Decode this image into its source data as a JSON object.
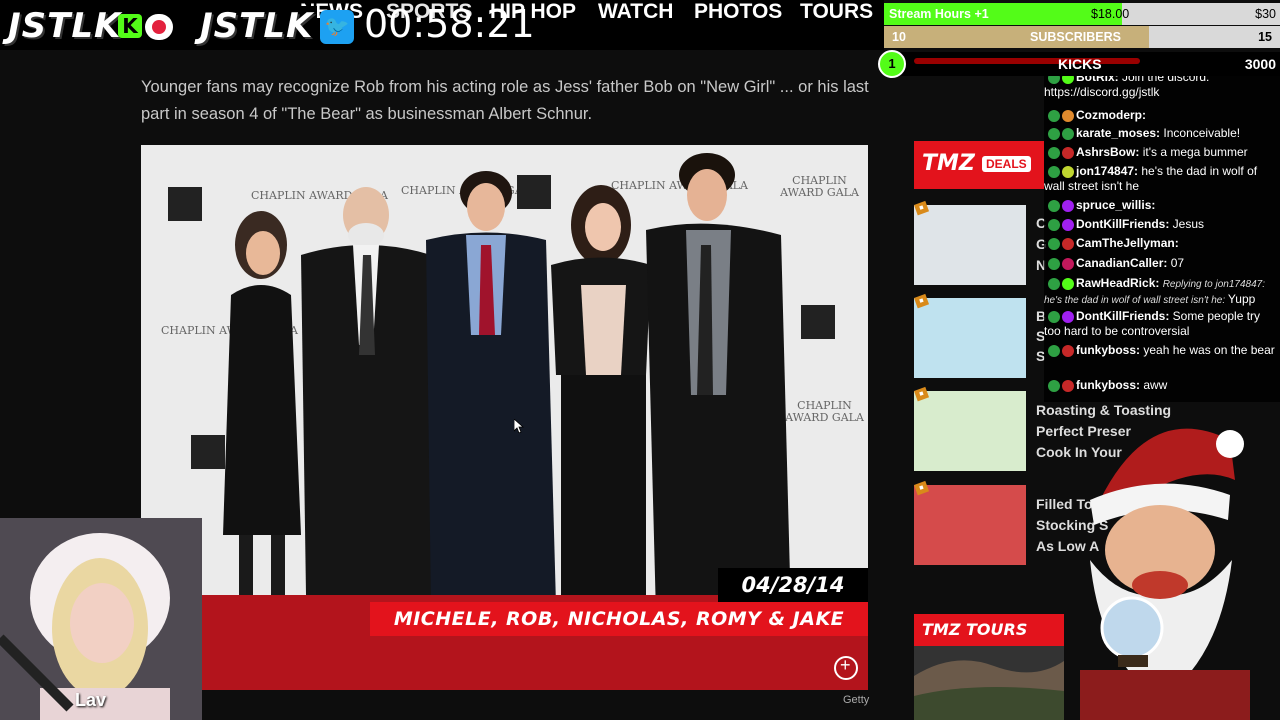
{
  "overlay": {
    "brand_left": "JSTLK",
    "brand_right": "JSTLK",
    "timer": "00:58:21",
    "stream_hours_label": "Stream Hours +1",
    "stream_hours_value": "$18.00",
    "stream_hours_goal": "$30",
    "stream_hours_progress": 0.6,
    "subs_current": "10",
    "subs_label": "SUBSCRIBERS",
    "subs_goal": "15",
    "subs_progress": 0.67,
    "kicks_current": "1",
    "kicks_label": "KICKS",
    "kicks_goal": "3000",
    "webcam_name": "Lav"
  },
  "nav": {
    "news": "NEWS",
    "sports": "SPORTS",
    "hiphop": "HIP HOP",
    "watch": "WATCH",
    "photos": "PHOTOS",
    "tours": "TOURS"
  },
  "article": {
    "paragraph": "Younger fans may recognize Rob from his acting role as Jess' father Bob on \"New Girl\" ... or his last part in season 4 of \"The Bear\" as businessman Albert Schnur.",
    "photo_date": "04/28/14",
    "photo_caption": "MICHELE, ROB, NICHOLAS, ROMY & JAKE",
    "photo_credit": "Getty",
    "wall_text": "CHAPLIN AWARD GALA"
  },
  "sidebar": {
    "deals_logo": "TMZ",
    "deals_label": "DEALS",
    "tours_label": "TMZ TOURS",
    "headlines": [
      "Roasting & Toasting",
      "Perfect Preser",
      "Cook In Your",
      "Filled To T",
      "Stocking S",
      "As Low A"
    ],
    "fragments": [
      "C",
      "G",
      "N",
      "B",
      "S",
      "S"
    ]
  },
  "chat": [
    {
      "user": "BotRix:",
      "text": "Join the discord: https://discord.gg/jstlk",
      "color": "#53fc18"
    },
    {
      "user": "Cozmoderp:",
      "text": "",
      "color": "#e08a2e"
    },
    {
      "user": "karate_moses:",
      "text": "Inconceivable!",
      "color": "#2ea043"
    },
    {
      "user": "AshrsBow:",
      "text": "it's a mega bummer",
      "color": "#c62828"
    },
    {
      "user": "jon174847:",
      "text": "he's the dad in wolf of wall street isn't he",
      "color": "#c0d630"
    },
    {
      "user": "spruce_willis:",
      "text": "",
      "color": "#a020f0"
    },
    {
      "user": "DontKillFriends:",
      "text": "Jesus",
      "color": "#a020f0"
    },
    {
      "user": "CamTheJellyman:",
      "text": "",
      "color": "#c62828"
    },
    {
      "user": "CanadianCaller:",
      "text": "07",
      "color": "#c2185b"
    },
    {
      "user": "RawHeadRick:",
      "reply": "Replying to jon174847: he's the dad in wolf of wall street isn't he:",
      "text": "Yupp",
      "color": "#53fc18"
    },
    {
      "user": "DontKillFriends:",
      "text": "Some people try too hard to be controversial",
      "color": "#a020f0"
    },
    {
      "user": "funkyboss:",
      "text": "yeah he was on the bear",
      "color": "#c62828"
    },
    {
      "user": "funkyboss:",
      "text": "aww",
      "color": "#c62828"
    }
  ]
}
